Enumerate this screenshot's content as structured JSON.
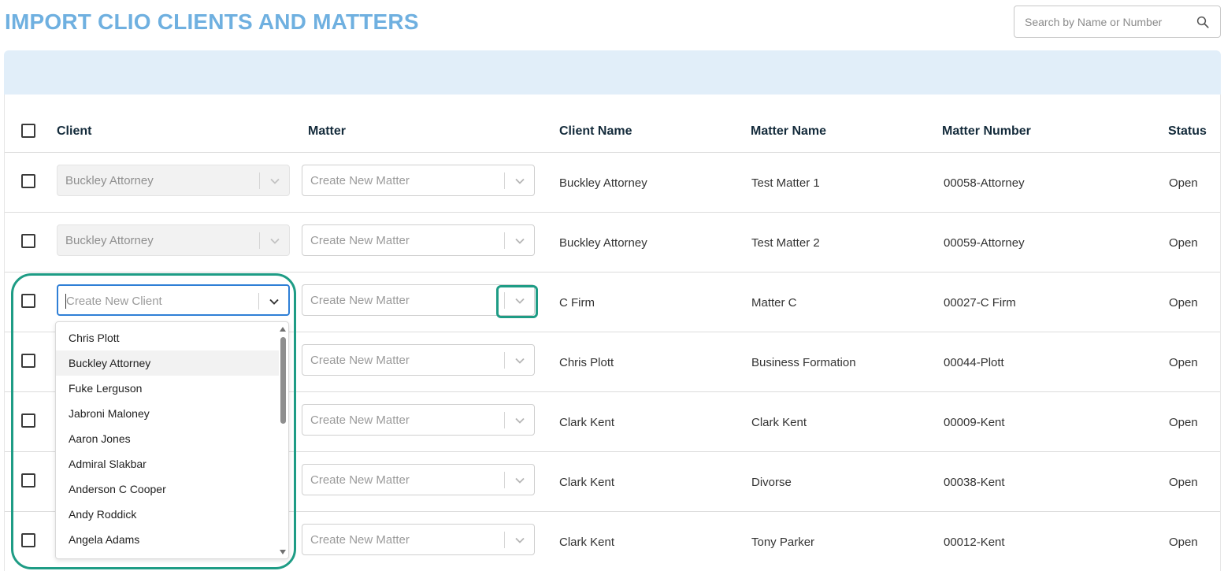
{
  "page": {
    "title": "IMPORT CLIO CLIENTS AND MATTERS"
  },
  "search": {
    "placeholder": "Search by Name or Number",
    "icon": "search-icon"
  },
  "table": {
    "headers": {
      "client": "Client",
      "matter": "Matter",
      "client_name": "Client Name",
      "matter_name": "Matter Name",
      "matter_number": "Matter Number",
      "status": "Status"
    },
    "rows": [
      {
        "client_select": "Buckley Attorney",
        "client_disabled": true,
        "matter_select": "Create New Matter",
        "client_name": "Buckley Attorney",
        "matter_name": "Test Matter 1",
        "matter_number": "00058-Attorney",
        "status": "Open"
      },
      {
        "client_select": "Buckley Attorney",
        "client_disabled": true,
        "matter_select": "Create New Matter",
        "client_name": "Buckley Attorney",
        "matter_name": "Test Matter 2",
        "matter_number": "00059-Attorney",
        "status": "Open"
      },
      {
        "client_select": "Create New Client",
        "client_disabled": false,
        "matter_select": "Create New Matter",
        "client_name": "C Firm",
        "matter_name": "Matter C",
        "matter_number": "00027-C Firm",
        "status": "Open"
      },
      {
        "client_select": "",
        "client_disabled": false,
        "matter_select": "Create New Matter",
        "client_name": "Chris Plott",
        "matter_name": "Business Formation",
        "matter_number": "00044-Plott",
        "status": "Open"
      },
      {
        "client_select": "",
        "client_disabled": false,
        "matter_select": "Create New Matter",
        "client_name": "Clark Kent",
        "matter_name": "Clark Kent",
        "matter_number": "00009-Kent",
        "status": "Open"
      },
      {
        "client_select": "",
        "client_disabled": false,
        "matter_select": "Create New Matter",
        "client_name": "Clark Kent",
        "matter_name": "Divorse",
        "matter_number": "00038-Kent",
        "status": "Open"
      },
      {
        "client_select": "",
        "client_disabled": false,
        "matter_select": "Create New Matter",
        "client_name": "Clark Kent",
        "matter_name": "Tony Parker",
        "matter_number": "00012-Kent",
        "status": "Open"
      }
    ]
  },
  "client_dropdown": {
    "options": [
      "Chris Plott",
      "Buckley Attorney",
      "Fuke Lerguson",
      "Jabroni Maloney",
      "Aaron Jones",
      "Admiral Slakbar",
      "Anderson C Cooper",
      "Andy Roddick",
      "Angela Adams"
    ],
    "hovered_option": "Buckley Attorney"
  },
  "colors": {
    "title": "#6fb0e0",
    "banner": "#e1eef9",
    "focus_border": "#2f7fd6",
    "highlight": "#1e9c85"
  }
}
